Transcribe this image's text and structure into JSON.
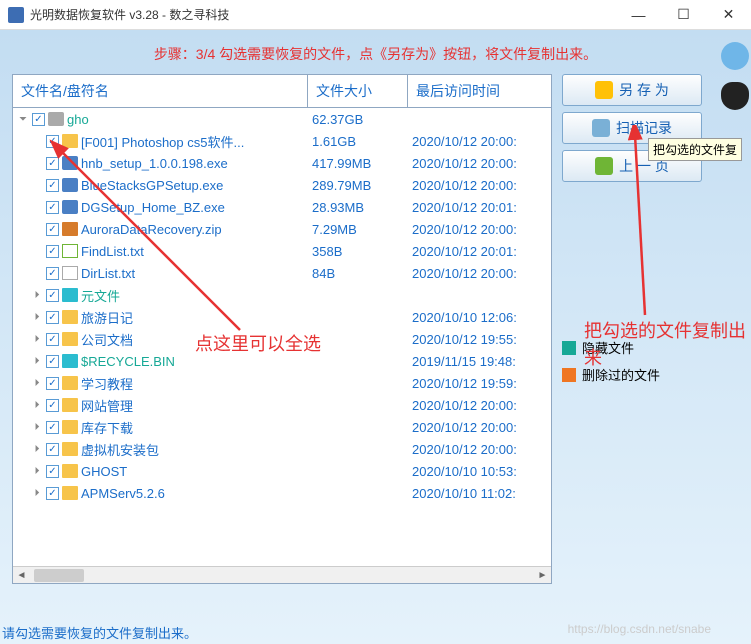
{
  "window": {
    "title": "光明数据恢复软件 v3.28 - 数之寻科技",
    "min": "—",
    "max": "☐",
    "close": "✕"
  },
  "instruction": "步骤：3/4 勾选需要恢复的文件，点《另存为》按钮，将文件复制出来。",
  "columns": {
    "name": "文件名/盘符名",
    "size": "文件大小",
    "time": "最后访问时间"
  },
  "rows": [
    {
      "indent": 0,
      "exp": "⏷",
      "icon": "drive",
      "name": "gho",
      "size": "62.37GB",
      "time": "",
      "cls": "teal"
    },
    {
      "indent": 1,
      "exp": "",
      "icon": "folder",
      "name": "[F001] Photoshop cs5软件...",
      "size": "1.61GB",
      "time": "2020/10/12 20:00:"
    },
    {
      "indent": 1,
      "exp": "",
      "icon": "exe",
      "name": "hnb_setup_1.0.0.198.exe",
      "size": "417.99MB",
      "time": "2020/10/12 20:00:"
    },
    {
      "indent": 1,
      "exp": "",
      "icon": "exe",
      "name": "BlueStacksGPSetup.exe",
      "size": "289.79MB",
      "time": "2020/10/12 20:00:"
    },
    {
      "indent": 1,
      "exp": "",
      "icon": "exe",
      "name": "DGSetup_Home_BZ.exe",
      "size": "28.93MB",
      "time": "2020/10/12 20:01:"
    },
    {
      "indent": 1,
      "exp": "",
      "icon": "zip",
      "name": "AuroraDataRecovery.zip",
      "size": "7.29MB",
      "time": "2020/10/12 20:00:"
    },
    {
      "indent": 1,
      "exp": "",
      "icon": "txt g",
      "name": "FindList.txt",
      "size": "358B",
      "time": "2020/10/12 20:01:"
    },
    {
      "indent": 1,
      "exp": "",
      "icon": "txt",
      "name": "DirList.txt",
      "size": "84B",
      "time": "2020/10/12 20:00:"
    },
    {
      "indent": 1,
      "exp": "⏵",
      "icon": "folder-t",
      "name": "元文件",
      "size": "",
      "time": "",
      "cls": "teal"
    },
    {
      "indent": 1,
      "exp": "⏵",
      "icon": "folder",
      "name": "旅游日记",
      "size": "",
      "time": "2020/10/10 12:06:"
    },
    {
      "indent": 1,
      "exp": "⏵",
      "icon": "folder",
      "name": "公司文档",
      "size": "",
      "time": "2020/10/12 19:55:"
    },
    {
      "indent": 1,
      "exp": "⏵",
      "icon": "folder-t",
      "name": "$RECYCLE.BIN",
      "size": "",
      "time": "2019/11/15 19:48:",
      "cls": "teal"
    },
    {
      "indent": 1,
      "exp": "⏵",
      "icon": "folder",
      "name": "学习教程",
      "size": "",
      "time": "2020/10/12 19:59:"
    },
    {
      "indent": 1,
      "exp": "⏵",
      "icon": "folder",
      "name": "网站管理",
      "size": "",
      "time": "2020/10/12 20:00:"
    },
    {
      "indent": 1,
      "exp": "⏵",
      "icon": "folder",
      "name": "库存下载",
      "size": "",
      "time": "2020/10/12 20:00:"
    },
    {
      "indent": 1,
      "exp": "⏵",
      "icon": "folder",
      "name": "虚拟机安装包",
      "size": "",
      "time": "2020/10/12 20:00:"
    },
    {
      "indent": 1,
      "exp": "⏵",
      "icon": "folder",
      "name": "GHOST",
      "size": "",
      "time": "2020/10/10 10:53:"
    },
    {
      "indent": 1,
      "exp": "⏵",
      "icon": "folder",
      "name": "APMServ5.2.6",
      "size": "",
      "time": "2020/10/10 11:02:"
    }
  ],
  "buttons": {
    "save": "另 存 为",
    "scan": "扫描记录",
    "prev": "上 一 页"
  },
  "tooltip": "把勾选的文件复",
  "legend": {
    "hidden": "隐藏文件",
    "deleted": "删除过的文件"
  },
  "annotations": {
    "selectall": "点这里可以全选",
    "copyout": "把勾选的文件复制出来"
  },
  "footer": "请勾选需要恢复的文件复制出来。",
  "watermark": "https://blog.csdn.net/snabe"
}
